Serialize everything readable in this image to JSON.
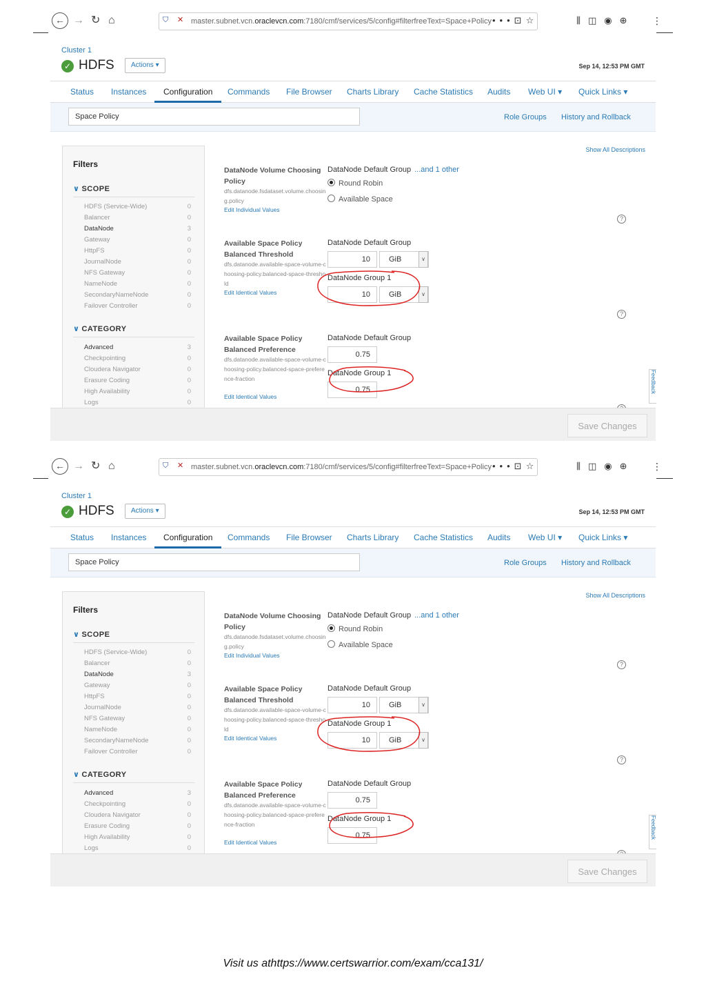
{
  "browser": {
    "url_prefix": "master.subnet.vcn.",
    "url_domain": "oraclevcn.com",
    "url_suffix": ":7180/cmf/services/5/config#filterfreeText=Space+Policy",
    "more_glyph": "•••"
  },
  "header": {
    "breadcrumb": "Cluster 1",
    "service_name": "HDFS",
    "actions_label": "Actions ▾",
    "timestamp": "Sep 14, 12:53 PM GMT",
    "status_color": "#4a9d3a"
  },
  "tabs": [
    "Status",
    "Instances",
    "Configuration",
    "Commands",
    "File Browser",
    "Charts Library",
    "Cache Statistics",
    "Audits",
    "Web UI ▾",
    "Quick Links ▾"
  ],
  "active_tab": "Configuration",
  "filterbar": {
    "search_value": "Space Policy",
    "role_groups": "Role Groups",
    "history": "History and Rollback"
  },
  "show_all": "Show All Descriptions",
  "filters": {
    "title": "Filters",
    "scope_title": "SCOPE",
    "scope": [
      {
        "label": "HDFS (Service-Wide)",
        "count": "0"
      },
      {
        "label": "Balancer",
        "count": "0"
      },
      {
        "label": "DataNode",
        "count": "3"
      },
      {
        "label": "Gateway",
        "count": "0"
      },
      {
        "label": "HttpFS",
        "count": "0"
      },
      {
        "label": "JournalNode",
        "count": "0"
      },
      {
        "label": "NFS Gateway",
        "count": "0"
      },
      {
        "label": "NameNode",
        "count": "0"
      },
      {
        "label": "SecondaryNameNode",
        "count": "0"
      },
      {
        "label": "Failover Controller",
        "count": "0"
      }
    ],
    "category_title": "CATEGORY",
    "category": [
      {
        "label": "Advanced",
        "count": "3"
      },
      {
        "label": "Checkpointing",
        "count": "0"
      },
      {
        "label": "Cloudera Navigator",
        "count": "0"
      },
      {
        "label": "Erasure Coding",
        "count": "0"
      },
      {
        "label": "High Availability",
        "count": "0"
      },
      {
        "label": "Logs",
        "count": "0"
      }
    ]
  },
  "configs": {
    "vol": {
      "name": "DataNode Volume Choosing Policy",
      "key": "dfs.datanode.fsdataset.volume.choosing.policy",
      "link": "Edit Individual Values",
      "group": "DataNode Default Group",
      "group_more": "...and 1 other",
      "opt1": "Round Robin",
      "opt2": "Available Space",
      "selected": "Round Robin"
    },
    "thr": {
      "name": "Available Space Policy Balanced Threshold",
      "key": "dfs.datanode.available-space-volume-choosing-policy.balanced-space-threshold",
      "link": "Edit Identical Values",
      "group1": "DataNode Default Group",
      "value1": "10",
      "unit1": "GiB",
      "group2": "DataNode Group 1",
      "value2": "10",
      "unit2": "GiB"
    },
    "pref": {
      "name": "Available Space Policy Balanced Preference",
      "key": "dfs.datanode.available-space-volume-choosing-policy.balanced-space-preference-fraction",
      "link": "Edit Identical Values",
      "group1": "DataNode Default Group",
      "value1": "0.75",
      "group2": "DataNode Group 1",
      "value2": "0.75"
    }
  },
  "feedback": "Feedback",
  "save_label": "Save Changes",
  "caption": "Visit us athttps://www.certswarrior.com/exam/cca131/"
}
